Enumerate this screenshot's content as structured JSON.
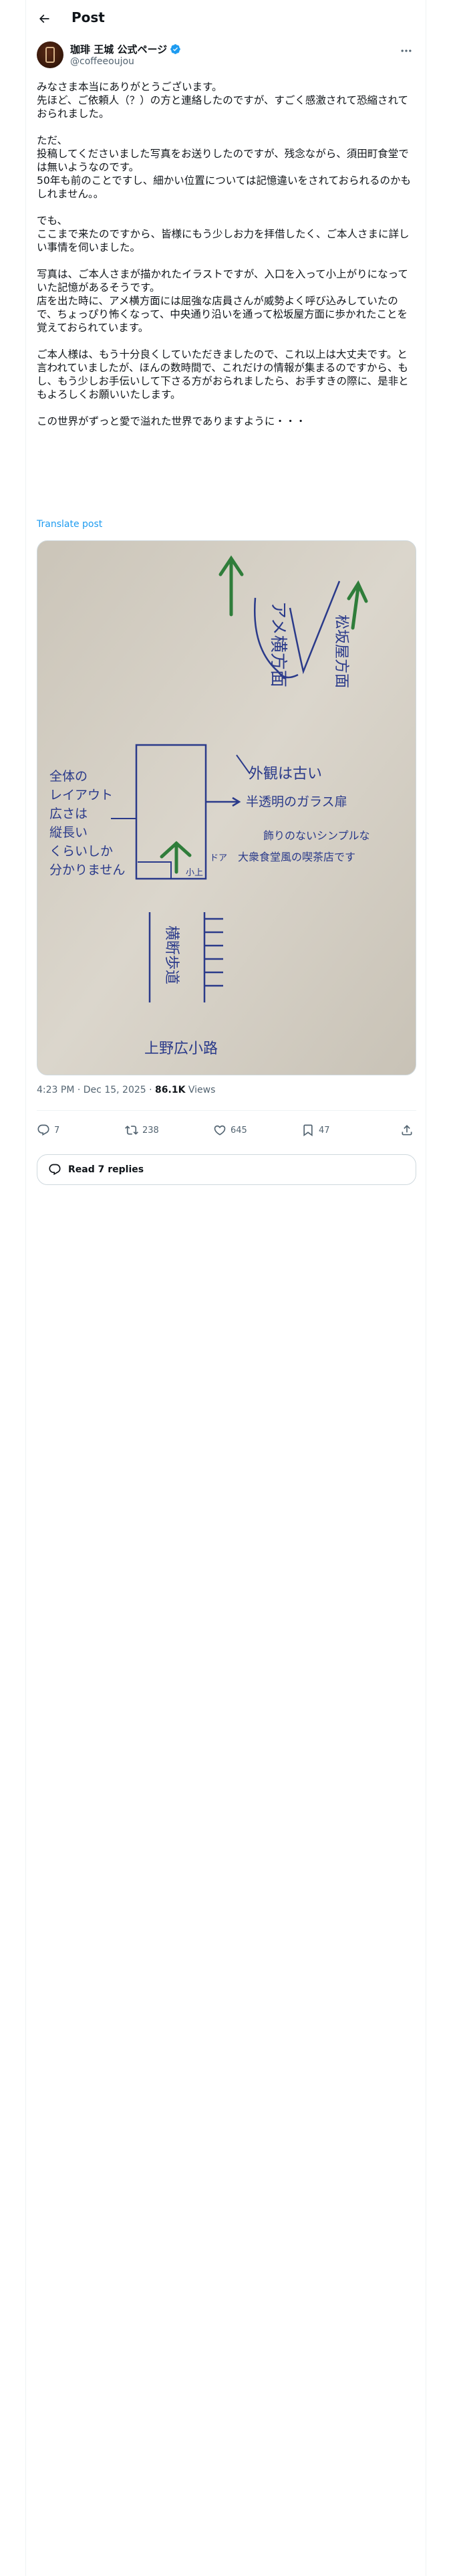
{
  "header": {
    "title": "Post"
  },
  "author": {
    "name": "珈琲 王城 公式ページ",
    "handle": "@coffeeoujou",
    "verified": true
  },
  "tweet": {
    "paragraphs": [
      [
        "みなさま本当にありがとうございます。",
        "先ほど、ご依頼人（？）の方と連絡したのですが、すごく感激されて恐縮されておられました。"
      ],
      [
        "ただ、",
        "投稿してくださいました写真をお送りしたのですが、残念ながら、須田町食堂では無いようなのです。",
        "50年も前のことですし、細かい位置については記憶違いをされておられるのかもしれません。。"
      ],
      [
        "でも、",
        "ここまで来たのですから、皆様にもう少しお力を拝借したく、ご本人さまに詳しい事情を伺いました。"
      ],
      [
        "写真は、ご本人さまが描かれたイラストですが、入口を入って小上がりになっていた記憶があるそうです。",
        "店を出た時に、アメ横方面には屈強な店員さんが威勢よく呼び込みしていたので、ちょっぴり怖くなって、中央通り沿いを通って松坂屋方面に歩かれたことを覚えておられています。"
      ],
      [
        "ご本人様は、もう十分良くしていただきましたので、これ以上は大丈夫です。と言われていましたが、ほんの数時間で、これだけの情報が集まるのですから、もし、もう少しお手伝いして下さる方がおられましたら、お手すきの際に、是非ともよろしくお願いいたします。"
      ],
      [
        "この世界がずっと愛で溢れた世界でありますように・・・"
      ]
    ],
    "translate_label": "Translate post"
  },
  "photo": {
    "drawing_labels": {
      "ameyoko": "アメ横方面",
      "matsuzakaya": "松坂屋方面",
      "exterior_1": "外観は古い",
      "exterior_2": "半透明のガラス扉",
      "interior_1": "飾りのないシンプルな",
      "interior_2": "大衆食堂風の喫茶店です",
      "layout_note_1": "全体の",
      "layout_note_2": "レイアウト",
      "layout_note_3": "広さは",
      "layout_note_4": "縦長い",
      "layout_note_5": "くらいしか",
      "layout_note_6": "分かりません",
      "crossing": "横断歩道",
      "station": "上野広小路",
      "door_mark": "ドア",
      "seat_mark": "小上"
    }
  },
  "meta": {
    "time": "4:23 PM",
    "date": "Dec 15, 2025",
    "separator": "·",
    "views_count": "86.1K",
    "views_label": "Views"
  },
  "actions": {
    "replies": "7",
    "reposts": "238",
    "likes": "645",
    "bookmarks": "47"
  },
  "read_replies": "Read 7 replies",
  "colors": {
    "accent": "#1d9bf0",
    "muted": "#536471",
    "text": "#0f1419",
    "border": "#eff3f4",
    "ink": "#2a3a8a",
    "arrow_green": "#2f7d3a"
  }
}
